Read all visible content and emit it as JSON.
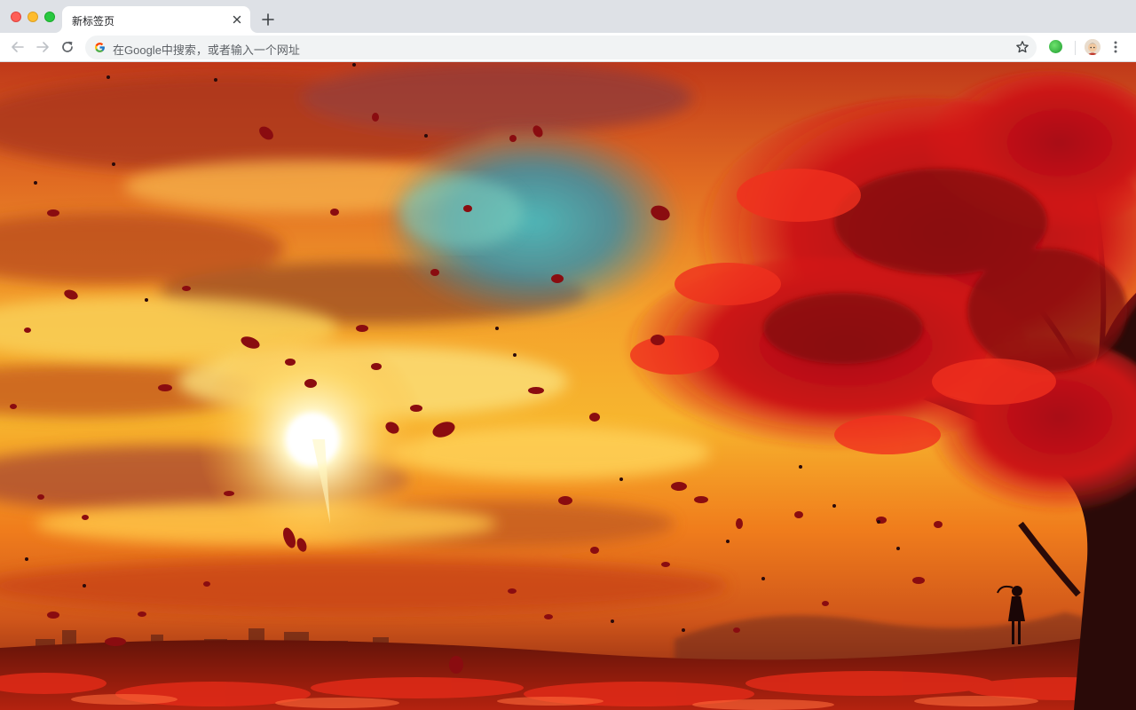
{
  "tab": {
    "title": "新标签页"
  },
  "omnibox": {
    "placeholder": "在Google中搜索，或者输入一个网址"
  },
  "icons": {
    "back": "arrow-left-icon",
    "forward": "arrow-right-icon",
    "reload": "reload-icon",
    "google": "google-g-icon",
    "bookmark": "star-icon",
    "extension": "green-circle-icon",
    "profile": "avatar-icon",
    "menu": "three-dot-menu-icon",
    "tab_close": "close-icon",
    "new_tab": "plus-icon"
  },
  "colors": {
    "tabstrip": "#dee1e6",
    "omnibox_bg": "#f1f3f4",
    "leaf_red": "#c8101a",
    "sky_orange": "#f48a1c",
    "sun_yellow": "#fff4b0",
    "sky_teal": "#3c9ab0"
  }
}
